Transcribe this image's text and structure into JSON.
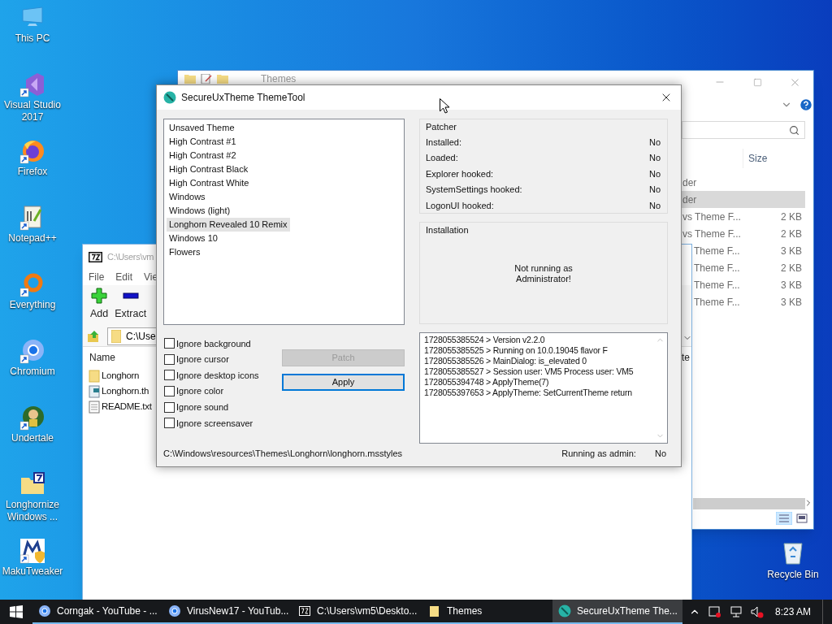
{
  "desktop_icons": [
    {
      "label": "This PC"
    },
    {
      "label": "Visual Studio 2017"
    },
    {
      "label": "Firefox"
    },
    {
      "label": "Notepad++"
    },
    {
      "label": "Everything"
    },
    {
      "label": "Chromium"
    },
    {
      "label": "Undertale"
    },
    {
      "label": "Longhornize Windows ..."
    },
    {
      "label": "MakuTweaker"
    }
  ],
  "recycle_bin": {
    "label": "Recycle Bin"
  },
  "explorer_window": {
    "title": "Themes",
    "column_header": "Size",
    "rows": [
      {
        "name": "der",
        "selected": false
      },
      {
        "name": "der",
        "selected": true
      },
      {
        "name": "vs Theme F...",
        "size": "2 KB",
        "selected": false
      },
      {
        "name": "vs Theme F...",
        "size": "2 KB",
        "selected": false
      },
      {
        "name": "Theme F...",
        "size": "3 KB",
        "selected": false
      },
      {
        "name": "Theme F...",
        "size": "2 KB",
        "selected": false
      },
      {
        "name": "Theme F...",
        "size": "3 KB",
        "selected": false
      },
      {
        "name": "Theme F...",
        "size": "3 KB",
        "selected": false
      }
    ]
  },
  "archive_window": {
    "title": "C:\\Users\\vm",
    "menu": [
      "File",
      "Edit",
      "Vie"
    ],
    "toolbar": [
      "Add",
      "Extract"
    ],
    "address": "C:\\Use",
    "column_header": "Name",
    "column_2": "te",
    "files": [
      {
        "name": "Longhorn",
        "kind": "folder"
      },
      {
        "name": "Longhorn.th",
        "kind": "theme"
      },
      {
        "name": "README.txt",
        "kind": "text"
      }
    ]
  },
  "dialog": {
    "title": "SecureUxTheme ThemeTool",
    "themes": [
      {
        "name": "Unsaved Theme",
        "selected": false
      },
      {
        "name": "High Contrast #1",
        "selected": false
      },
      {
        "name": "High Contrast #2",
        "selected": false
      },
      {
        "name": "High Contrast Black",
        "selected": false
      },
      {
        "name": "High Contrast White",
        "selected": false
      },
      {
        "name": "Windows",
        "selected": false
      },
      {
        "name": "Windows (light)",
        "selected": false
      },
      {
        "name": "Longhorn Revealed 10 Remix",
        "selected": true
      },
      {
        "name": "Windows 10",
        "selected": false
      },
      {
        "name": "Flowers",
        "selected": false
      }
    ],
    "patcher": {
      "title": "Patcher",
      "rows": [
        {
          "label": "Installed:",
          "value": "No"
        },
        {
          "label": "Loaded:",
          "value": "No"
        },
        {
          "label": "Explorer hooked:",
          "value": "No"
        },
        {
          "label": "SystemSettings hooked:",
          "value": "No"
        },
        {
          "label": "LogonUI hooked:",
          "value": "No"
        }
      ]
    },
    "installation": {
      "title": "Installation",
      "message": [
        "Not running as",
        "Administrator!"
      ]
    },
    "options": [
      {
        "label": "Ignore background",
        "checked": false
      },
      {
        "label": "Ignore cursor",
        "checked": false
      },
      {
        "label": "Ignore desktop icons",
        "checked": false
      },
      {
        "label": "Ignore color",
        "checked": false
      },
      {
        "label": "Ignore sound",
        "checked": false
      },
      {
        "label": "Ignore screensaver",
        "checked": false
      }
    ],
    "buttons": [
      {
        "label": "Patch",
        "disabled": true,
        "focused": false
      },
      {
        "label": "Apply",
        "disabled": false,
        "focused": true
      }
    ],
    "log": [
      "1728055385524 > Version v2.2.0",
      "1728055385525 > Running on 10.0.19045 flavor F",
      "1728055385526 > MainDialog: is_elevated 0",
      "1728055385527 > Session user: VM5 Process user: VM5",
      "1728055394748 > ApplyTheme(7)",
      "1728055397653 > ApplyTheme: SetCurrentTheme return"
    ],
    "path": "C:\\Windows\\resources\\Themes\\Longhorn\\longhorn.msstyles",
    "admin_label": "Running as admin:",
    "admin_value": "No"
  },
  "taskbar": {
    "items": [
      {
        "label": "Corngak - YouTube - ...",
        "selected": false
      },
      {
        "label": "VirusNew17 - YouTub...",
        "selected": false
      },
      {
        "label": "C:\\Users\\vm5\\Deskto...",
        "selected": false
      },
      {
        "label": "Themes",
        "selected": false
      },
      {
        "label": "SecureUxTheme The...",
        "selected": true
      }
    ],
    "clock": "8:23 AM"
  }
}
